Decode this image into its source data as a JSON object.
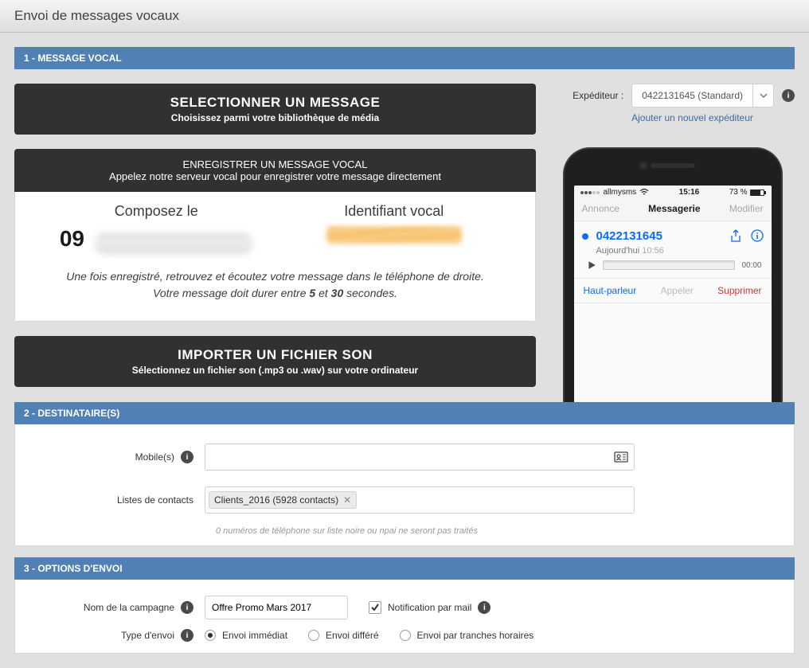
{
  "page": {
    "title": "Envoi de messages vocaux"
  },
  "sections": {
    "s1": "1 - MESSAGE VOCAL",
    "s2": "2 - DESTINATAIRE(S)",
    "s3": "3 - OPTIONS D'ENVOI"
  },
  "select_box": {
    "title": "SELECTIONNER UN MESSAGE",
    "sub": "Choisissez parmi votre bibliothèque de média"
  },
  "record_box": {
    "title": "ENREGISTRER UN MESSAGE VOCAL",
    "sub": "Appelez notre serveur vocal pour enregistrer votre message directement",
    "compose_label": "Composez le",
    "compose_number_prefix": "09",
    "id_label": "Identifiant vocal",
    "info_line_1": "Une fois enregistré, retrouvez et écoutez votre message dans le téléphone de droite.",
    "info_line_2a": "Votre message doit durer entre ",
    "info_line_2b": "5",
    "info_line_2c": " et ",
    "info_line_2d": "30",
    "info_line_2e": " secondes."
  },
  "import_box": {
    "title": "IMPORTER UN FICHIER SON",
    "sub": "Sélectionnez un fichier son (.mp3 ou .wav) sur votre ordinateur"
  },
  "expeditor": {
    "label": "Expéditeur :",
    "value": "0422131645 (Standard)",
    "add_link": "Ajouter un nouvel expéditeur"
  },
  "phone": {
    "carrier": "allmysms",
    "time": "15:16",
    "battery_pct": "73 %",
    "tab_left": "Annonce",
    "tab_mid": "Messagerie",
    "tab_right": "Modifier",
    "item_number": "0422131645",
    "item_day": "Aujourd'hui",
    "item_time": "10:56",
    "duration": "00:00",
    "action_hp": "Haut-parleur",
    "action_call": "Appeler",
    "action_del": "Supprimer"
  },
  "dest": {
    "mobile_label": "Mobile(s)",
    "lists_label": "Listes de contacts",
    "chip_text": "Clients_2016 (5928 contacts)",
    "note": "0 numéros de téléphone sur liste noire ou npai ne seront pas traités"
  },
  "options": {
    "campaign_label": "Nom de la campagne",
    "campaign_value": "Offre Promo Mars 2017",
    "notif_label": "Notification par mail",
    "type_label": "Type d'envoi",
    "type_immediate": "Envoi immédiat",
    "type_deferred": "Envoi différé",
    "type_slots": "Envoi par tranches horaires"
  }
}
